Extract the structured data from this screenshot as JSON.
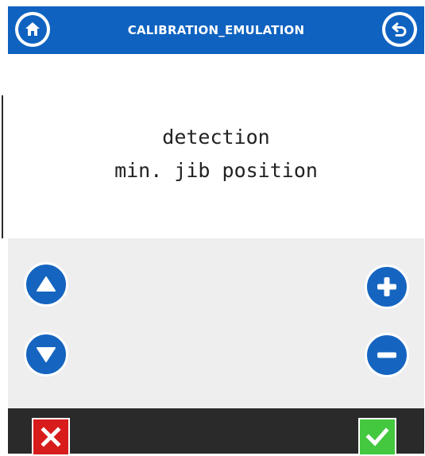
{
  "header": {
    "title": "CALIBRATION_EMULATION",
    "home_icon": "home-icon",
    "back_icon": "back-arrow-icon"
  },
  "message": {
    "line1": "detection",
    "line2": "min. jib position"
  },
  "controls": {
    "up_icon": "arrow-up-icon",
    "down_icon": "arrow-down-icon",
    "plus_icon": "plus-icon",
    "minus_icon": "minus-icon"
  },
  "footer": {
    "cancel_icon": "close-icon",
    "confirm_icon": "checkmark-icon"
  },
  "colors": {
    "header_blue": "#0f62c0",
    "button_blue": "#1565c0",
    "cancel_red": "#d81b1b",
    "confirm_green": "#43c83f",
    "footer_dark": "#2a2a2a",
    "controls_gray": "#eeeeee"
  }
}
